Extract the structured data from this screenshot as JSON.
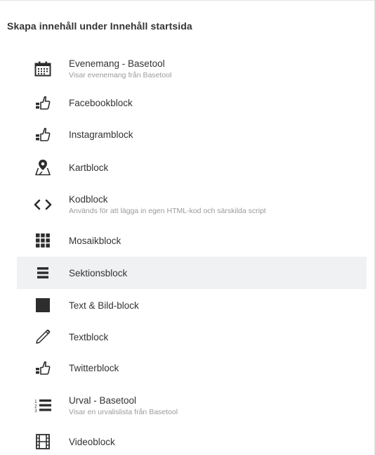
{
  "panel": {
    "title": "Skapa innehåll under Innehåll startsida",
    "items": [
      {
        "icon": "calendar-icon",
        "label": "Evenemang - Basetool",
        "desc": "Visar evenemang från Basetool"
      },
      {
        "icon": "thumbs-up-icon",
        "label": "Facebookblock",
        "desc": ""
      },
      {
        "icon": "thumbs-up-icon",
        "label": "Instagramblock",
        "desc": ""
      },
      {
        "icon": "map-marker-icon",
        "label": "Kartblock",
        "desc": ""
      },
      {
        "icon": "code-icon",
        "label": "Kodblock",
        "desc": "Används för att lägga in egen HTML-kod och särskilda script"
      },
      {
        "icon": "grid-icon",
        "label": "Mosaikblock",
        "desc": ""
      },
      {
        "icon": "sections-icon",
        "label": "Sektionsblock",
        "desc": "",
        "active": true
      },
      {
        "icon": "square-icon",
        "label": "Text & Bild-block",
        "desc": ""
      },
      {
        "icon": "pencil-icon",
        "label": "Textblock",
        "desc": ""
      },
      {
        "icon": "thumbs-up-icon",
        "label": "Twitterblock",
        "desc": ""
      },
      {
        "icon": "numbered-list-icon",
        "label": "Urval - Basetool",
        "desc": "Visar en urvalislista från Basetool"
      },
      {
        "icon": "film-icon",
        "label": "Videoblock",
        "desc": ""
      }
    ]
  },
  "colors": {
    "icon": "#2d2d2d",
    "active_bg": "#f0f1f3",
    "desc": "#9a9a9a"
  }
}
